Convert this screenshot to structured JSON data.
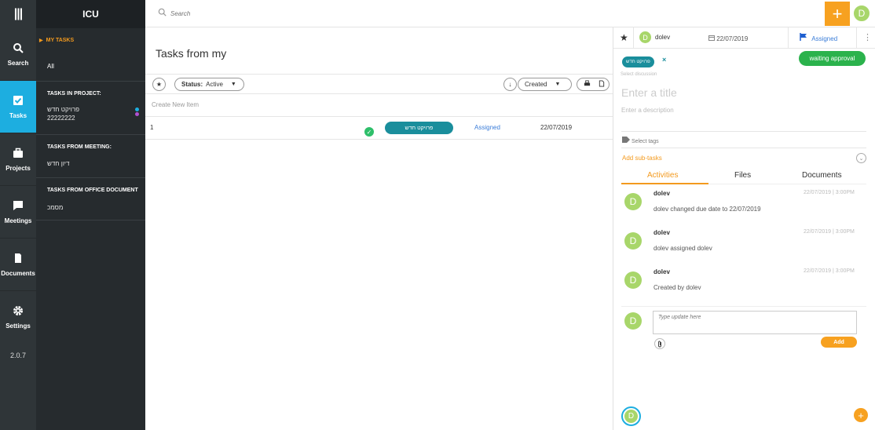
{
  "app": {
    "brand": "ICU",
    "version": "2.0.7"
  },
  "rail": {
    "items": [
      {
        "label": "Search",
        "icon": "search-icon"
      },
      {
        "label": "Tasks",
        "icon": "tasks-icon"
      },
      {
        "label": "Projects",
        "icon": "projects-icon"
      },
      {
        "label": "Meetings",
        "icon": "meetings-icon"
      },
      {
        "label": "Documents",
        "icon": "documents-icon"
      },
      {
        "label": "Settings",
        "icon": "settings-icon"
      }
    ]
  },
  "sidebar": {
    "my_tasks": "MY TASKS",
    "all": "All",
    "tasks_in_project": "TASKS IN PROJECT:",
    "projects": [
      {
        "name": "פרויקט חדש",
        "color": "#1daee0"
      },
      {
        "name": "22222222",
        "color": "#b050d0"
      }
    ],
    "tasks_from_meeting": "TASKS FROM MEETING:",
    "meetings": [
      "דיון חדש"
    ],
    "tasks_from_office": "TASKS FROM OFFICE DOCUMENT",
    "documents": [
      "מסמכ"
    ]
  },
  "topbar": {
    "search_placeholder": "Search",
    "plus": "+",
    "avatar": "D"
  },
  "list": {
    "title": "Tasks from my",
    "status_label": "Status:",
    "status_value": "Active",
    "sort_label": "Created",
    "create_new": "Create New Item",
    "rows": [
      {
        "num": "1",
        "project": "פרויקט חדש",
        "status": "Assigned",
        "date": "22/07/2019"
      }
    ]
  },
  "detail": {
    "owner": "dolev",
    "owner_avatar": "D",
    "due_date": "22/07/2019",
    "assigned": "Assigned",
    "waiting": "waiting approval",
    "tag": "פרויקט חדש",
    "select_discussion": "Select discussion",
    "title_placeholder": "Enter a title",
    "description_placeholder": "Enter a description",
    "select_tags": "Select tags",
    "add_subtasks": "Add sub-tasks",
    "tabs": [
      "Activities",
      "Files",
      "Documents"
    ],
    "activities": [
      {
        "who": "dolev",
        "when": "22/07/2019 | 3:00PM",
        "text": "dolev changed due date to 22/07/2019"
      },
      {
        "who": "dolev",
        "when": "22/07/2019 | 3:00PM",
        "text": "dolev assigned dolev"
      },
      {
        "who": "dolev",
        "when": "22/07/2019 | 3:00PM",
        "text": "Created by dolev"
      }
    ],
    "update_placeholder": "Type update here",
    "add_label": "Add"
  }
}
